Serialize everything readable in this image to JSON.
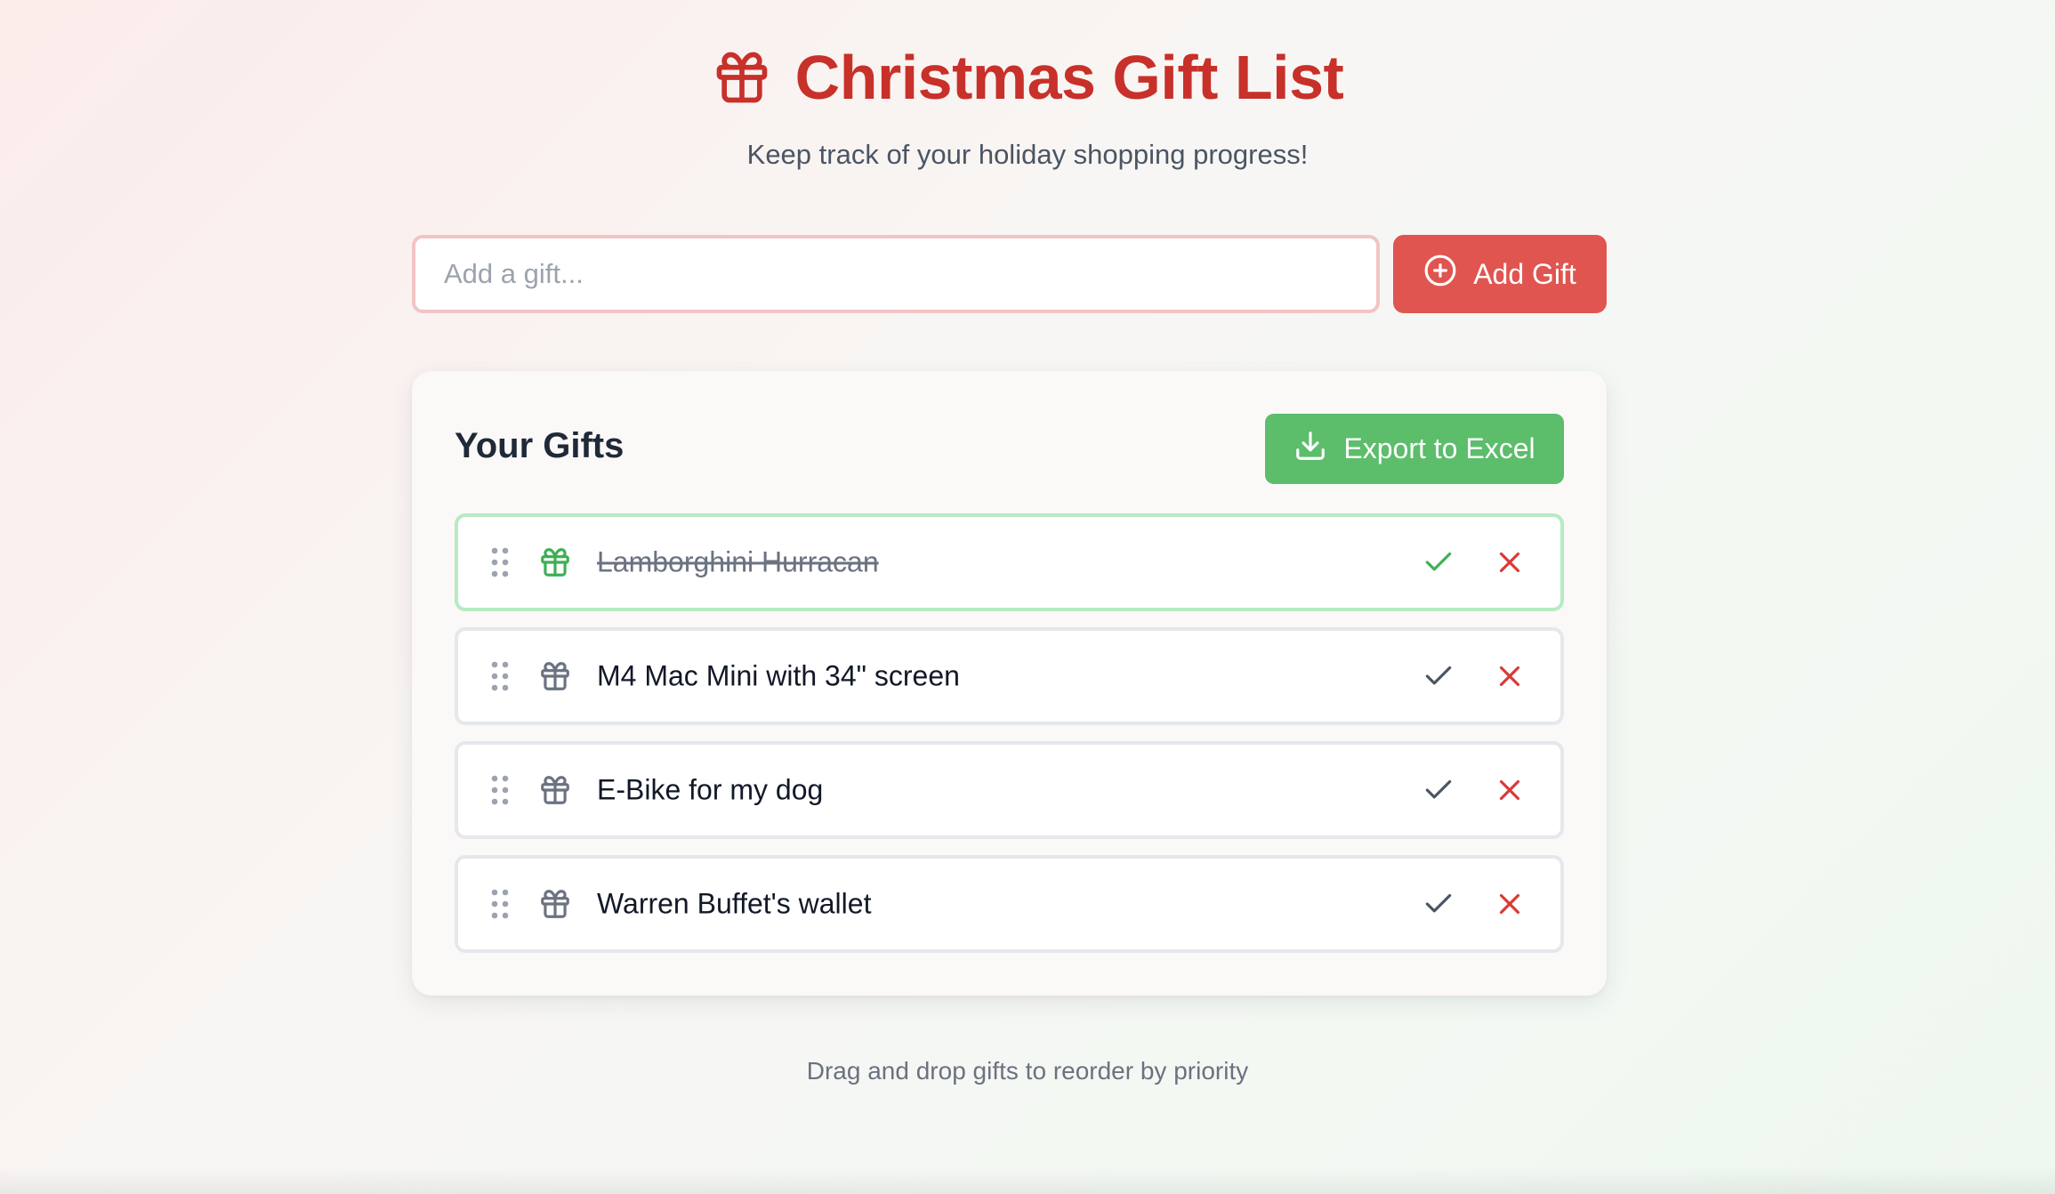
{
  "header": {
    "title": "Christmas Gift List",
    "subtitle": "Keep track of your holiday shopping progress!",
    "icon": "gift-icon"
  },
  "add_form": {
    "placeholder": "Add a gift...",
    "value": "",
    "button_label": "Add Gift",
    "button_icon": "plus-circle-icon"
  },
  "gifts_card": {
    "title": "Your Gifts",
    "export_label": "Export to Excel",
    "export_icon": "download-icon",
    "items": [
      {
        "name": "Lamborghini Hurracan",
        "done": true
      },
      {
        "name": "M4 Mac Mini with 34\" screen",
        "done": false
      },
      {
        "name": "E-Bike for my dog",
        "done": false
      },
      {
        "name": "Warren Buffet's wallet",
        "done": false
      }
    ]
  },
  "footer": {
    "hint": "Drag and drop gifts to reorder by priority"
  },
  "colors": {
    "title_red": "#c8302a",
    "add_button": "#e05550",
    "export_button": "#5cbd6b",
    "done_green": "#3fae55",
    "remove_red": "#d93a36"
  }
}
